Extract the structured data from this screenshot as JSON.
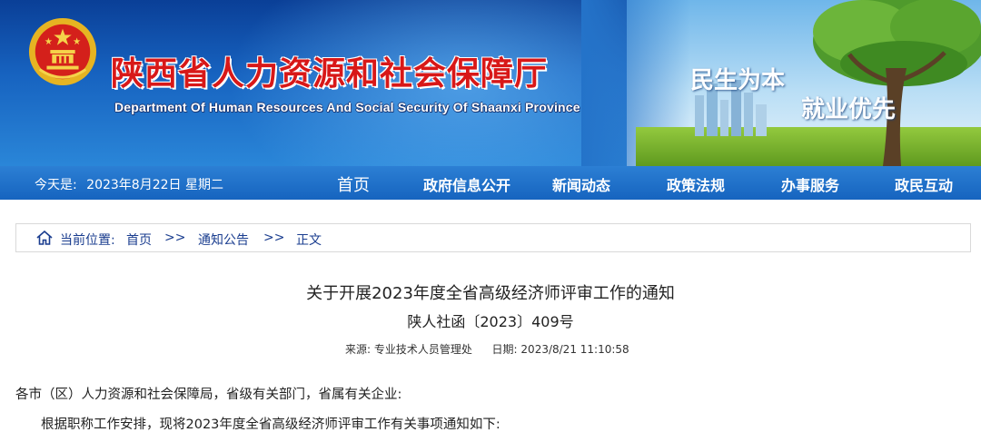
{
  "header": {
    "title_cn": "陕西省人力资源和社会保障厅",
    "title_en": "Department Of Human Resources And Social Security Of Shaanxi Province",
    "slogan_line1": "民生为本",
    "slogan_line2": "就业优先",
    "emblem_icon": "national-emblem-icon",
    "colors": {
      "title_red": "#d81818",
      "banner_blue": "#1763c0"
    }
  },
  "nav": {
    "date_label": "今天是:",
    "date_value": "2023年8月22日 星期二",
    "items": [
      "首页",
      "政府信息公开",
      "新闻动态",
      "政策法规",
      "办事服务",
      "政民互动"
    ]
  },
  "breadcrumb": {
    "icon": "home-icon",
    "label": "当前位置:",
    "items": [
      "首页",
      "通知公告",
      "正文"
    ],
    "separator": ">>"
  },
  "article": {
    "title": "关于开展2023年度全省高级经济师评审工作的通知",
    "doc_number": "陕人社函〔2023〕409号",
    "source_label": "来源:",
    "source_value": "专业技术人员管理处",
    "date_label": "日期:",
    "date_value": "2023/8/21 11:10:58",
    "salutation": "各市（区）人力资源和社会保障局，省级有关部门，省属有关企业:",
    "paragraph1": "根据职称工作安排，现将2023年度全省高级经济师评审工作有关事项通知如下:"
  }
}
